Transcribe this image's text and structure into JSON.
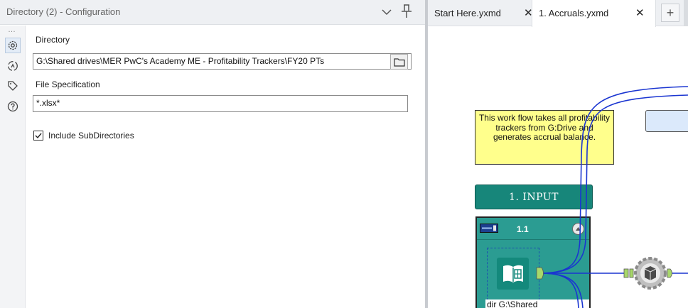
{
  "config_panel": {
    "title": "Directory (2) - Configuration",
    "rail_dots": "…",
    "directory_label": "Directory",
    "directory_value": "G:\\Shared drives\\MER PwC's Academy ME - Profitability Trackers\\FY20 PTs",
    "file_spec_label": "File Specification",
    "file_spec_value": "*.xlsx*",
    "include_subdirs_label": "Include SubDirectories",
    "include_subdirs_checked": true
  },
  "tabs": [
    {
      "label": "Start Here.yxmd",
      "close": "✕",
      "active": false
    },
    {
      "label": "1. Accruals.yxmd",
      "close": "✕",
      "active": true
    }
  ],
  "new_tab_label": "+",
  "workflow": {
    "comment_text": "This work flow takes all profitability trackers from G:Drive and generates accrual balance.",
    "banner_text": "1. INPUT",
    "container_id": "1.1",
    "tool_caption": "dir G:\\Shared",
    "colors": {
      "accent_teal": "#17867a",
      "container_teal": "#2b9c92",
      "comment_yellow": "#ffff8c",
      "connection_blue": "#1a35d1",
      "anchor_green": "#a8d86a"
    }
  }
}
